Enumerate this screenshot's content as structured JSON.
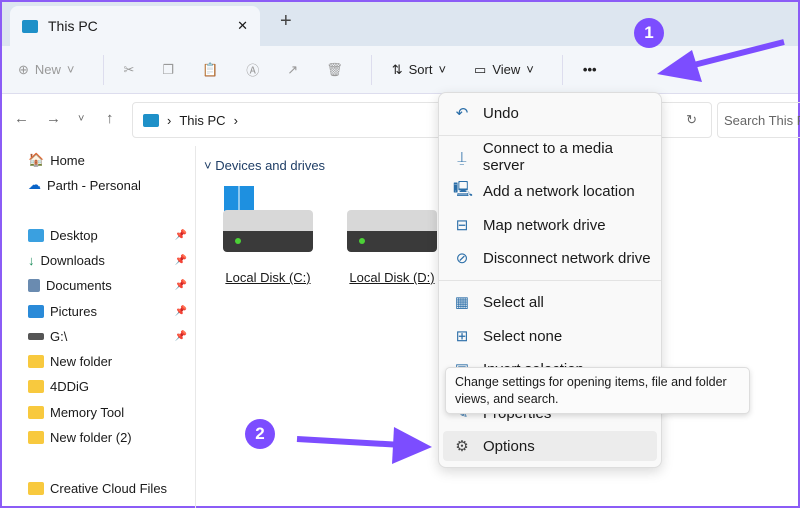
{
  "tab": {
    "title": "This PC",
    "close": "✕",
    "new_tab": "+"
  },
  "toolbar": {
    "new": "New",
    "sort": "Sort",
    "view": "View",
    "more": "•••"
  },
  "address": {
    "path": "This PC",
    "search_placeholder": "Search This PC"
  },
  "sidebar": {
    "items": [
      {
        "label": "Home"
      },
      {
        "label": "Parth - Personal"
      },
      {
        "label": "Desktop"
      },
      {
        "label": "Downloads"
      },
      {
        "label": "Documents"
      },
      {
        "label": "Pictures"
      },
      {
        "label": "G:\\"
      },
      {
        "label": "New folder"
      },
      {
        "label": "4DDiG"
      },
      {
        "label": "Memory Tool"
      },
      {
        "label": "New folder (2)"
      },
      {
        "label": "Creative Cloud Files"
      }
    ]
  },
  "main": {
    "section": "Devices and drives",
    "drives": [
      {
        "label": "Local Disk (C:)"
      },
      {
        "label": "Local Disk (D:)"
      }
    ]
  },
  "menu": {
    "items": [
      {
        "label": "Undo"
      },
      {
        "label": "Connect to a media server"
      },
      {
        "label": "Add a network location"
      },
      {
        "label": "Map network drive"
      },
      {
        "label": "Disconnect network drive"
      },
      {
        "label": "Select all"
      },
      {
        "label": "Select none"
      },
      {
        "label": "Invert selection"
      },
      {
        "label": "Properties"
      },
      {
        "label": "Options"
      }
    ]
  },
  "tooltip": "Change settings for opening items, file and folder views, and search.",
  "annotations": {
    "badge1": "1",
    "badge2": "2",
    "color": "#7c4dff"
  }
}
